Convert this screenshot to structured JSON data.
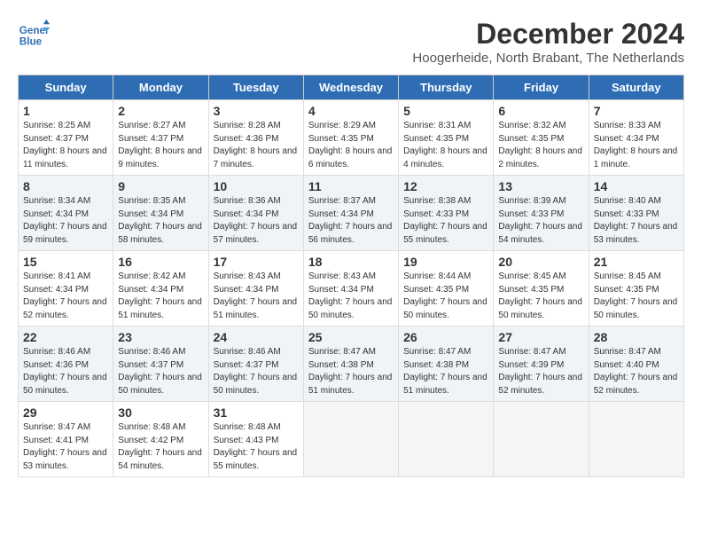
{
  "logo": {
    "line1": "General",
    "line2": "Blue"
  },
  "title": "December 2024",
  "subtitle": "Hoogerheide, North Brabant, The Netherlands",
  "days_of_week": [
    "Sunday",
    "Monday",
    "Tuesday",
    "Wednesday",
    "Thursday",
    "Friday",
    "Saturday"
  ],
  "weeks": [
    [
      {
        "day": "1",
        "sunrise": "8:25 AM",
        "sunset": "4:37 PM",
        "daylight": "8 hours and 11 minutes."
      },
      {
        "day": "2",
        "sunrise": "8:27 AM",
        "sunset": "4:37 PM",
        "daylight": "8 hours and 9 minutes."
      },
      {
        "day": "3",
        "sunrise": "8:28 AM",
        "sunset": "4:36 PM",
        "daylight": "8 hours and 7 minutes."
      },
      {
        "day": "4",
        "sunrise": "8:29 AM",
        "sunset": "4:35 PM",
        "daylight": "8 hours and 6 minutes."
      },
      {
        "day": "5",
        "sunrise": "8:31 AM",
        "sunset": "4:35 PM",
        "daylight": "8 hours and 4 minutes."
      },
      {
        "day": "6",
        "sunrise": "8:32 AM",
        "sunset": "4:35 PM",
        "daylight": "8 hours and 2 minutes."
      },
      {
        "day": "7",
        "sunrise": "8:33 AM",
        "sunset": "4:34 PM",
        "daylight": "8 hours and 1 minute."
      }
    ],
    [
      {
        "day": "8",
        "sunrise": "8:34 AM",
        "sunset": "4:34 PM",
        "daylight": "7 hours and 59 minutes."
      },
      {
        "day": "9",
        "sunrise": "8:35 AM",
        "sunset": "4:34 PM",
        "daylight": "7 hours and 58 minutes."
      },
      {
        "day": "10",
        "sunrise": "8:36 AM",
        "sunset": "4:34 PM",
        "daylight": "7 hours and 57 minutes."
      },
      {
        "day": "11",
        "sunrise": "8:37 AM",
        "sunset": "4:34 PM",
        "daylight": "7 hours and 56 minutes."
      },
      {
        "day": "12",
        "sunrise": "8:38 AM",
        "sunset": "4:33 PM",
        "daylight": "7 hours and 55 minutes."
      },
      {
        "day": "13",
        "sunrise": "8:39 AM",
        "sunset": "4:33 PM",
        "daylight": "7 hours and 54 minutes."
      },
      {
        "day": "14",
        "sunrise": "8:40 AM",
        "sunset": "4:33 PM",
        "daylight": "7 hours and 53 minutes."
      }
    ],
    [
      {
        "day": "15",
        "sunrise": "8:41 AM",
        "sunset": "4:34 PM",
        "daylight": "7 hours and 52 minutes."
      },
      {
        "day": "16",
        "sunrise": "8:42 AM",
        "sunset": "4:34 PM",
        "daylight": "7 hours and 51 minutes."
      },
      {
        "day": "17",
        "sunrise": "8:43 AM",
        "sunset": "4:34 PM",
        "daylight": "7 hours and 51 minutes."
      },
      {
        "day": "18",
        "sunrise": "8:43 AM",
        "sunset": "4:34 PM",
        "daylight": "7 hours and 50 minutes."
      },
      {
        "day": "19",
        "sunrise": "8:44 AM",
        "sunset": "4:35 PM",
        "daylight": "7 hours and 50 minutes."
      },
      {
        "day": "20",
        "sunrise": "8:45 AM",
        "sunset": "4:35 PM",
        "daylight": "7 hours and 50 minutes."
      },
      {
        "day": "21",
        "sunrise": "8:45 AM",
        "sunset": "4:35 PM",
        "daylight": "7 hours and 50 minutes."
      }
    ],
    [
      {
        "day": "22",
        "sunrise": "8:46 AM",
        "sunset": "4:36 PM",
        "daylight": "7 hours and 50 minutes."
      },
      {
        "day": "23",
        "sunrise": "8:46 AM",
        "sunset": "4:37 PM",
        "daylight": "7 hours and 50 minutes."
      },
      {
        "day": "24",
        "sunrise": "8:46 AM",
        "sunset": "4:37 PM",
        "daylight": "7 hours and 50 minutes."
      },
      {
        "day": "25",
        "sunrise": "8:47 AM",
        "sunset": "4:38 PM",
        "daylight": "7 hours and 51 minutes."
      },
      {
        "day": "26",
        "sunrise": "8:47 AM",
        "sunset": "4:38 PM",
        "daylight": "7 hours and 51 minutes."
      },
      {
        "day": "27",
        "sunrise": "8:47 AM",
        "sunset": "4:39 PM",
        "daylight": "7 hours and 52 minutes."
      },
      {
        "day": "28",
        "sunrise": "8:47 AM",
        "sunset": "4:40 PM",
        "daylight": "7 hours and 52 minutes."
      }
    ],
    [
      {
        "day": "29",
        "sunrise": "8:47 AM",
        "sunset": "4:41 PM",
        "daylight": "7 hours and 53 minutes."
      },
      {
        "day": "30",
        "sunrise": "8:48 AM",
        "sunset": "4:42 PM",
        "daylight": "7 hours and 54 minutes."
      },
      {
        "day": "31",
        "sunrise": "8:48 AM",
        "sunset": "4:43 PM",
        "daylight": "7 hours and 55 minutes."
      },
      null,
      null,
      null,
      null
    ]
  ],
  "labels": {
    "sunrise": "Sunrise:",
    "sunset": "Sunset:",
    "daylight": "Daylight:"
  }
}
